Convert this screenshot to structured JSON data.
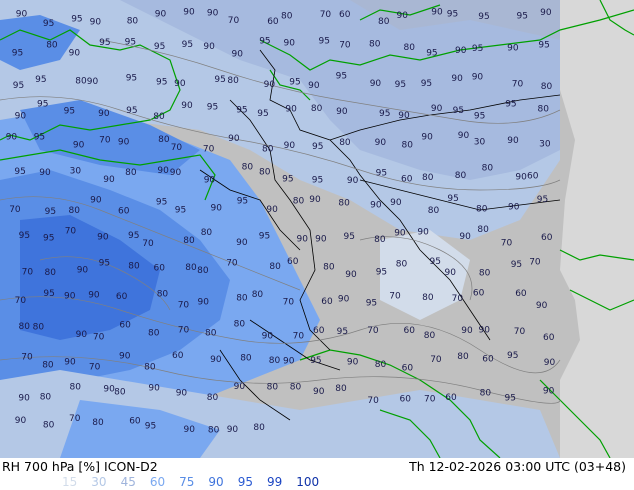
{
  "footer": {
    "title": "RH 700 hPa [%] ICON-D2",
    "timestamp": "Th 12-02-2026 03:00 UTC (03+48)"
  },
  "legend": [
    {
      "value": "15",
      "color": "#d2dcea"
    },
    {
      "value": "30",
      "color": "#b4c8e6"
    },
    {
      "value": "45",
      "color": "#9fb4dc"
    },
    {
      "value": "60",
      "color": "#7aa8f0"
    },
    {
      "value": "75",
      "color": "#5a8ee6"
    },
    {
      "value": "90",
      "color": "#3f74dc"
    },
    {
      "value": "95",
      "color": "#2a5ad2"
    },
    {
      "value": "99",
      "color": "#1a44c2"
    },
    {
      "value": "100",
      "color": "#0f32a8"
    }
  ],
  "map": {
    "colors": {
      "land_background": "#c0c0c0",
      "sea_background": "#9fa6b8",
      "humid_light": "#b4c8e6",
      "humid_mid": "#7aa8f0",
      "humid_high": "#3f74dc",
      "coastline": "#00a000",
      "border": "#000000",
      "contour": "#808080"
    },
    "contour_labels": [
      "90",
      "95",
      "95",
      "90",
      "80",
      "90",
      "90",
      "90",
      "70",
      "60",
      "80",
      "70",
      "60",
      "80",
      "90",
      "90",
      "95",
      "95",
      "95",
      "90",
      "95",
      "80",
      "90",
      "95",
      "95",
      "95",
      "95",
      "90",
      "90",
      "95",
      "90",
      "95",
      "70",
      "80",
      "80",
      "95",
      "90",
      "95",
      "90",
      "95",
      "95",
      "95",
      "80",
      "90",
      "95",
      "95",
      "90",
      "95",
      "80",
      "90",
      "95",
      "90",
      "95",
      "90",
      "95",
      "95",
      "90",
      "90",
      "70",
      "80",
      "90",
      "95",
      "95",
      "90",
      "95",
      "80",
      "90",
      "95",
      "95",
      "95",
      "90",
      "80",
      "90",
      "95",
      "90",
      "90",
      "95",
      "95",
      "95",
      "80",
      "90",
      "95",
      "90",
      "70",
      "90",
      "80",
      "70",
      "70",
      "90",
      "80",
      "90",
      "95",
      "80",
      "90",
      "80",
      "90",
      "90",
      "30",
      "90",
      "30",
      "95",
      "90",
      "30",
      "90",
      "80",
      "90",
      "90",
      "90",
      "80",
      "80",
      "95",
      "95",
      "90",
      "95",
      "60",
      "80",
      "80",
      "80",
      "90",
      "60",
      "70",
      "95",
      "80",
      "90",
      "60",
      "95",
      "95",
      "90",
      "95",
      "90",
      "80",
      "90",
      "80",
      "90",
      "90",
      "80",
      "95",
      "80",
      "90",
      "95",
      "95",
      "95",
      "70",
      "90",
      "95",
      "70",
      "80",
      "80",
      "90",
      "95",
      "90",
      "90",
      "95",
      "80",
      "90",
      "90",
      "90",
      "80",
      "70",
      "60",
      "70",
      "80",
      "90",
      "95",
      "80",
      "60",
      "80",
      "80",
      "70",
      "80",
      "60",
      "80",
      "90",
      "95",
      "80",
      "95",
      "90",
      "80",
      "95",
      "70",
      "70",
      "95",
      "90",
      "90",
      "60",
      "80",
      "70",
      "90",
      "80",
      "80",
      "70",
      "60",
      "90",
      "95",
      "70",
      "80",
      "70",
      "60",
      "60",
      "90",
      "80",
      "80",
      "90",
      "70",
      "60",
      "80",
      "70",
      "80",
      "80",
      "90",
      "70",
      "60",
      "95",
      "70",
      "60",
      "80",
      "90",
      "90",
      "70",
      "60",
      "70",
      "80",
      "90",
      "70",
      "90",
      "80",
      "60",
      "90",
      "80",
      "80",
      "90",
      "95",
      "90",
      "80",
      "60",
      "70",
      "80",
      "60",
      "95",
      "90",
      "90",
      "80",
      "80",
      "90",
      "80",
      "90",
      "90",
      "80",
      "90",
      "80",
      "80",
      "90",
      "80",
      "70",
      "60",
      "70",
      "60",
      "80",
      "95",
      "90",
      "90",
      "80",
      "70",
      "80",
      "60",
      "95",
      "90",
      "80",
      "90",
      "80"
    ]
  }
}
